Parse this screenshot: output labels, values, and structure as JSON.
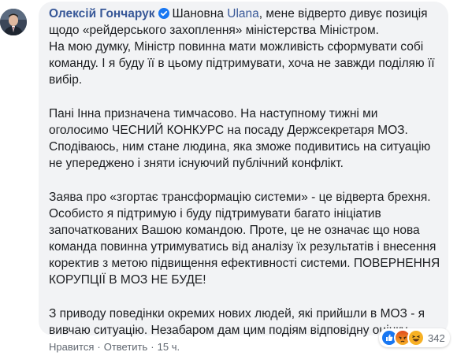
{
  "comment": {
    "author": "Олексій Гончарук",
    "greeting_before": "Шановна",
    "mention": "Ulana",
    "paragraphs": {
      "p1_rest": ", мене відверто дивує позиція щодо «рейдерського захоплення» міністерства Міністром.",
      "p2": "На мою думку, Міністр повинна мати можливість сформувати собі команду. І я буду її в цьому підтримувати, хоча не завжди поділяю її вибір.",
      "p3": "Пані Інна призначена тимчасово. На наступному тижні ми оголосимо ЧЕСНИЙ КОНКУРС на посаду Держсекретаря МОЗ. Сподіваюсь, ним стане людина, яка зможе подивитись на ситуацію не упереджено і зняти існуючий публічний конфлікт.",
      "p4": "Заява про «згортає трансформацію системи» - це відверта брехня. Особисто я підтримую і буду підтримувати багато ініціатив започаткованих Вашою командою. Проте, це не означає що нова команда повинна утримуватись від аналізу їх результатів і внесення коректив з метою підвищення ефективності системи. ПОВЕРНЕННЯ КОРУПЦІЇ В МОЗ НЕ БУДЕ!",
      "p5": "З приводу поведінки окремих нових людей, які прийшли в МОЗ - я вивчаю ситуацію. Незабаром дам цим подіям відповідну оцінку."
    }
  },
  "actions": {
    "like": "Нравится",
    "reply": "Ответить",
    "time": "15 ч."
  },
  "reactions": {
    "icons": [
      "like-icon",
      "angry-icon",
      "haha-icon"
    ],
    "count": "342"
  },
  "colors": {
    "link": "#385898",
    "bubble": "#f2f3f5",
    "text": "#1c1e21",
    "meta": "#606770",
    "like": "#1877f2",
    "angry": "#e9710f",
    "haha": "#f7b125"
  }
}
